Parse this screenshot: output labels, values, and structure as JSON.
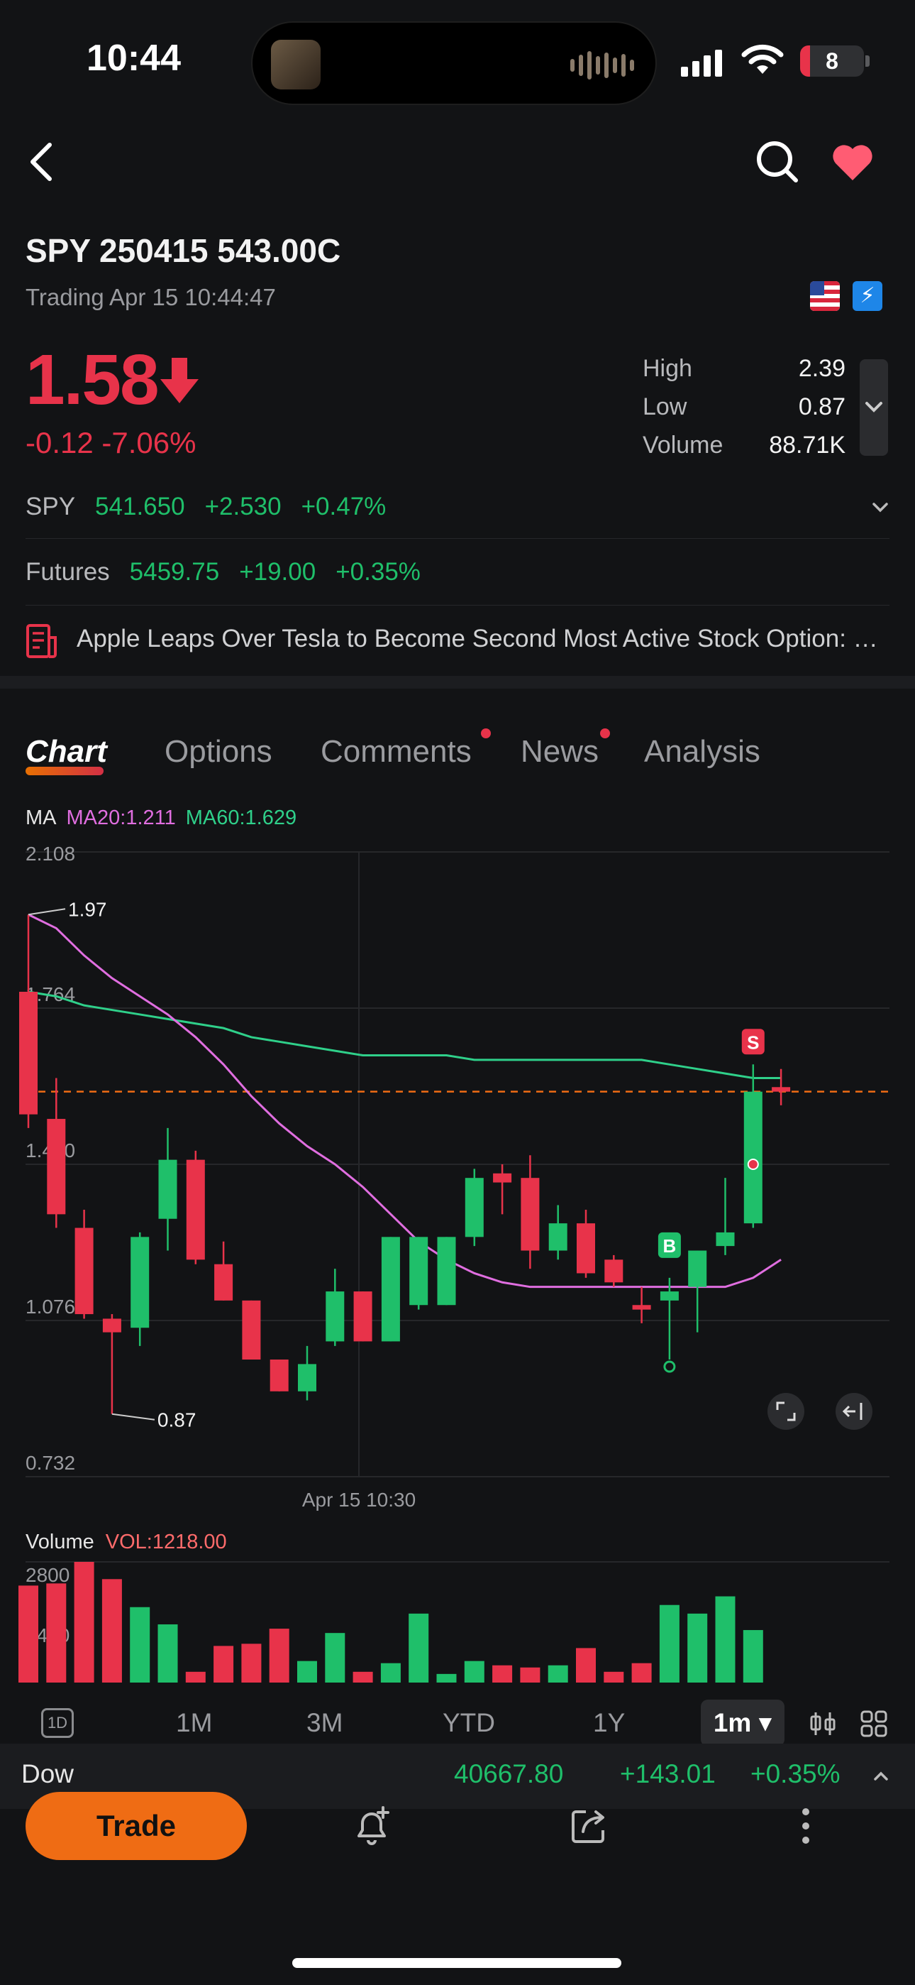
{
  "status": {
    "time": "10:44",
    "battery": "8"
  },
  "header": {
    "title": "SPY 250415 543.00C",
    "subtitle": "Trading Apr 15 10:44:47",
    "price": "1.58",
    "change": "-0.12 -7.06%",
    "stats": [
      {
        "label": "High",
        "value": "2.39"
      },
      {
        "label": "Low",
        "value": "0.87"
      },
      {
        "label": "Volume",
        "value": "88.71K"
      }
    ],
    "badge_market": "US",
    "badge_feature": "2"
  },
  "underlying": {
    "symbol": "SPY",
    "price": "541.650",
    "change": "+2.530",
    "pct": "+0.47%"
  },
  "futures": {
    "label": "Futures",
    "price": "5459.75",
    "change": "+19.00",
    "pct": "+0.35%"
  },
  "news": {
    "headline": "Apple Leaps Over Tesla to Become Second Most Active Stock Option: Options Data"
  },
  "tabs": [
    {
      "label": "Chart",
      "active": true,
      "dot": false
    },
    {
      "label": "Options",
      "active": false,
      "dot": false
    },
    {
      "label": "Comments",
      "active": false,
      "dot": true
    },
    {
      "label": "News",
      "active": false,
      "dot": true
    },
    {
      "label": "Analysis",
      "active": false,
      "dot": false
    }
  ],
  "ma_legend": {
    "label": "MA",
    "ma20": "MA20:1.211",
    "ma60": "MA60:1.629"
  },
  "chart_data": {
    "type": "candlestick",
    "y_ticks": [
      "2.108",
      "1.764",
      "1.420",
      "1.076",
      "0.732"
    ],
    "ylim": [
      0.732,
      2.108
    ],
    "x_tick": "Apr 15 10:30",
    "annotations": {
      "max": "1.97",
      "min": "0.87",
      "current_price": 1.58,
      "buy_marker": "B",
      "sell_marker": "S"
    },
    "candles": [
      {
        "o": 1.8,
        "c": 1.53,
        "h": 1.97,
        "l": 1.5
      },
      {
        "o": 1.52,
        "c": 1.31,
        "h": 1.61,
        "l": 1.28
      },
      {
        "o": 1.28,
        "c": 1.09,
        "h": 1.32,
        "l": 1.08
      },
      {
        "o": 1.08,
        "c": 1.05,
        "h": 1.09,
        "l": 0.87
      },
      {
        "o": 1.06,
        "c": 1.26,
        "h": 1.27,
        "l": 1.02
      },
      {
        "o": 1.3,
        "c": 1.43,
        "h": 1.5,
        "l": 1.23
      },
      {
        "o": 1.43,
        "c": 1.21,
        "h": 1.45,
        "l": 1.2
      },
      {
        "o": 1.2,
        "c": 1.12,
        "h": 1.25,
        "l": 1.12
      },
      {
        "o": 1.12,
        "c": 0.99,
        "h": 1.12,
        "l": 0.99
      },
      {
        "o": 0.99,
        "c": 0.92,
        "h": 0.99,
        "l": 0.92
      },
      {
        "o": 0.92,
        "c": 0.98,
        "h": 1.02,
        "l": 0.9
      },
      {
        "o": 1.03,
        "c": 1.14,
        "h": 1.19,
        "l": 1.02
      },
      {
        "o": 1.14,
        "c": 1.03,
        "h": 1.14,
        "l": 1.03
      },
      {
        "o": 1.03,
        "c": 1.26,
        "h": 1.26,
        "l": 1.03
      },
      {
        "o": 1.11,
        "c": 1.26,
        "h": 1.26,
        "l": 1.1
      },
      {
        "o": 1.11,
        "c": 1.26,
        "h": 1.26,
        "l": 1.11
      },
      {
        "o": 1.26,
        "c": 1.39,
        "h": 1.41,
        "l": 1.24
      },
      {
        "o": 1.4,
        "c": 1.38,
        "h": 1.42,
        "l": 1.31
      },
      {
        "o": 1.39,
        "c": 1.23,
        "h": 1.44,
        "l": 1.19
      },
      {
        "o": 1.23,
        "c": 1.29,
        "h": 1.33,
        "l": 1.21
      },
      {
        "o": 1.29,
        "c": 1.18,
        "h": 1.32,
        "l": 1.17
      },
      {
        "o": 1.21,
        "c": 1.16,
        "h": 1.22,
        "l": 1.15
      },
      {
        "o": 1.11,
        "c": 1.1,
        "h": 1.15,
        "l": 1.07
      },
      {
        "o": 1.12,
        "c": 1.14,
        "h": 1.17,
        "l": 0.99
      },
      {
        "o": 1.15,
        "c": 1.23,
        "h": 1.23,
        "l": 1.05
      },
      {
        "o": 1.24,
        "c": 1.27,
        "h": 1.39,
        "l": 1.22
      },
      {
        "o": 1.29,
        "c": 1.58,
        "h": 1.64,
        "l": 1.28
      },
      {
        "o": 1.59,
        "c": 1.58,
        "h": 1.63,
        "l": 1.55
      }
    ],
    "ma20": [
      1.97,
      1.94,
      1.88,
      1.83,
      1.79,
      1.75,
      1.7,
      1.64,
      1.57,
      1.51,
      1.46,
      1.42,
      1.37,
      1.31,
      1.25,
      1.21,
      1.18,
      1.16,
      1.15,
      1.15,
      1.15,
      1.15,
      1.15,
      1.15,
      1.15,
      1.15,
      1.17,
      1.21
    ],
    "ma60": [
      1.8,
      1.79,
      1.77,
      1.76,
      1.75,
      1.74,
      1.73,
      1.72,
      1.7,
      1.69,
      1.68,
      1.67,
      1.66,
      1.66,
      1.66,
      1.66,
      1.65,
      1.65,
      1.65,
      1.65,
      1.65,
      1.65,
      1.65,
      1.64,
      1.63,
      1.62,
      1.61,
      1.61
    ],
    "volume": {
      "label": "Volume",
      "current": "VOL:1218.00",
      "ticks": [
        "2800",
        "1400"
      ],
      "max": 2800,
      "values": [
        2250,
        2300,
        2800,
        2400,
        1750,
        1350,
        250,
        850,
        900,
        1250,
        500,
        1150,
        250,
        450,
        1600,
        200,
        500,
        400,
        350,
        400,
        800,
        250,
        450,
        1800,
        1600,
        2000,
        1218
      ]
    }
  },
  "ranges": [
    "1M",
    "3M",
    "YTD",
    "1Y"
  ],
  "range_1d": "1D",
  "active_interval": "1m",
  "index_bar": {
    "name": "Dow",
    "value": "40667.80",
    "change": "+143.01",
    "pct": "+0.35%"
  },
  "trade_label": "Trade",
  "colors": {
    "up": "#1fbf6a",
    "down": "#e8334a",
    "accent": "#ef6c14",
    "ma20": "#e06ee0",
    "ma60": "#2fd08a"
  }
}
